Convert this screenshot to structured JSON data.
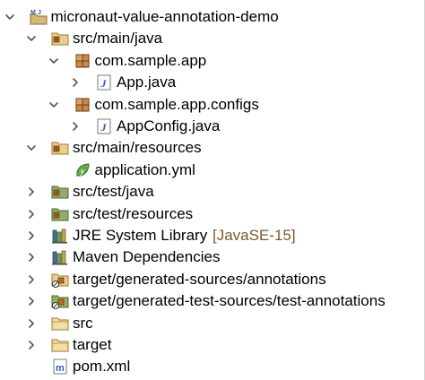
{
  "tree": {
    "items": [
      {
        "label": "micronaut-value-annotation-demo",
        "decoration": "",
        "expanded": true,
        "has_children": true,
        "icon": "maven-java-project-icon",
        "depth": 0
      },
      {
        "label": "src/main/java",
        "decoration": "",
        "expanded": true,
        "has_children": true,
        "icon": "source-folder-icon",
        "depth": 1
      },
      {
        "label": "com.sample.app",
        "decoration": "",
        "expanded": true,
        "has_children": true,
        "icon": "package-icon",
        "depth": 2
      },
      {
        "label": "App.java",
        "decoration": "",
        "expanded": false,
        "has_children": true,
        "icon": "java-file-icon",
        "depth": 3
      },
      {
        "label": "com.sample.app.configs",
        "decoration": "",
        "expanded": true,
        "has_children": true,
        "icon": "package-icon",
        "depth": 2
      },
      {
        "label": "AppConfig.java",
        "decoration": "",
        "expanded": false,
        "has_children": true,
        "icon": "java-file-icon",
        "depth": 3
      },
      {
        "label": "src/main/resources",
        "decoration": "",
        "expanded": true,
        "has_children": true,
        "icon": "source-folder-icon",
        "depth": 1
      },
      {
        "label": "application.yml",
        "decoration": "",
        "expanded": false,
        "has_children": false,
        "icon": "yaml-file-icon",
        "depth": 2
      },
      {
        "label": "src/test/java",
        "decoration": "",
        "expanded": false,
        "has_children": true,
        "icon": "test-source-folder-icon",
        "depth": 1
      },
      {
        "label": "src/test/resources",
        "decoration": "",
        "expanded": false,
        "has_children": true,
        "icon": "test-source-folder-icon",
        "depth": 1
      },
      {
        "label": "JRE System Library",
        "decoration": "[JavaSE-15]",
        "expanded": false,
        "has_children": true,
        "icon": "library-icon",
        "depth": 1
      },
      {
        "label": "Maven Dependencies",
        "decoration": "",
        "expanded": false,
        "has_children": true,
        "icon": "library-icon",
        "depth": 1
      },
      {
        "label": "target/generated-sources/annotations",
        "decoration": "",
        "expanded": false,
        "has_children": true,
        "icon": "generated-source-folder-icon",
        "depth": 1
      },
      {
        "label": "target/generated-test-sources/test-annotations",
        "decoration": "",
        "expanded": false,
        "has_children": true,
        "icon": "generated-test-source-folder-icon",
        "depth": 1
      },
      {
        "label": "src",
        "decoration": "",
        "expanded": false,
        "has_children": true,
        "icon": "folder-icon",
        "depth": 1
      },
      {
        "label": "target",
        "decoration": "",
        "expanded": false,
        "has_children": true,
        "icon": "folder-icon",
        "depth": 1
      },
      {
        "label": "pom.xml",
        "decoration": "",
        "expanded": false,
        "has_children": false,
        "icon": "maven-pom-icon",
        "depth": 1
      }
    ]
  },
  "colors": {
    "background": "#ffffff",
    "text": "#000000",
    "decoration": "#7a5a2c",
    "chevron": "#555555",
    "java_blue": "#2a5db0",
    "folder_tan": "#c9a35d",
    "package_brown": "#8b5a2b",
    "yaml_green": "#6aa84f"
  }
}
